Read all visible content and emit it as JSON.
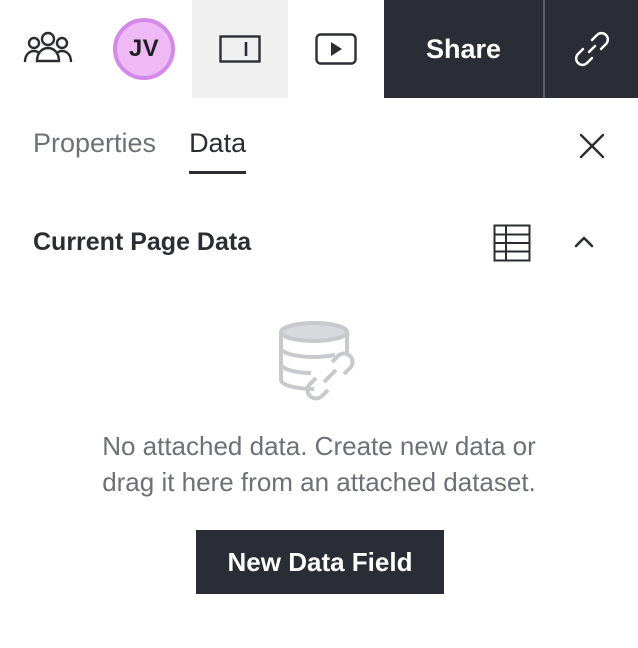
{
  "toolbar": {
    "avatar_initials": "JV",
    "share_label": "Share",
    "accent_avatar": "#eeb9f4",
    "dark_bg": "#2a2d36"
  },
  "tabs": [
    {
      "label": "Properties",
      "selected": false
    },
    {
      "label": "Data",
      "selected": true
    }
  ],
  "section": {
    "title": "Current Page Data"
  },
  "empty_state": {
    "line1": "No attached data. Create new data or",
    "line2": "drag it here from an attached dataset.",
    "button_label": "New Data Field"
  },
  "icons": [
    "users-icon",
    "sidebar-panel-icon",
    "present-icon",
    "link-icon",
    "close-icon",
    "table-icon",
    "chevron-up-icon",
    "database-link-icon"
  ]
}
